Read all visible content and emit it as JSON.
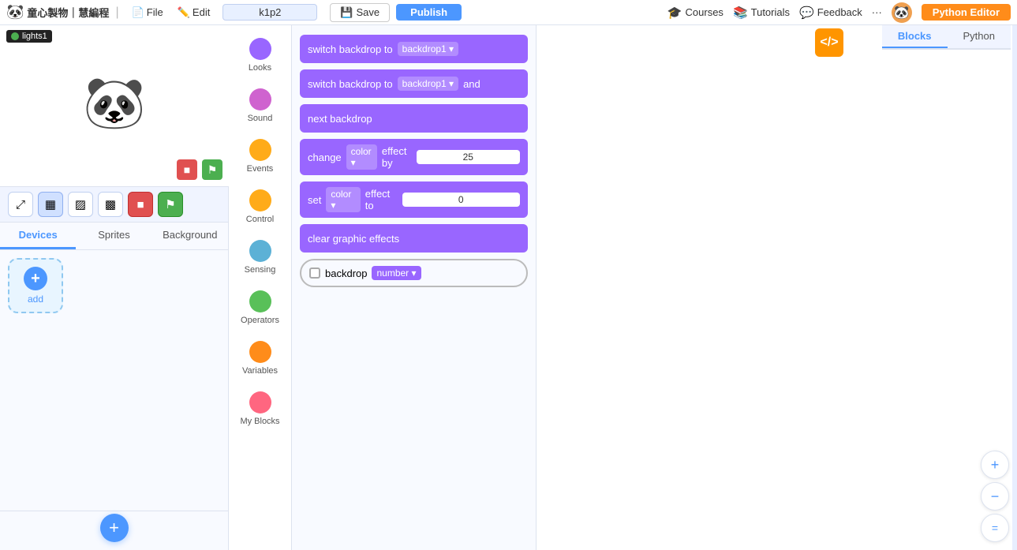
{
  "topbar": {
    "logo_text": "童心製物｜慧編程",
    "menu_file": "File",
    "menu_edit": "Edit",
    "project_name": "k1p2",
    "btn_save": "Save",
    "btn_publish": "Publish",
    "btn_courses": "Courses",
    "btn_tutorials": "Tutorials",
    "btn_feedback": "Feedback",
    "btn_python_editor": "Python Editor"
  },
  "view_controls": {
    "btn_expand": "⤢",
    "btn_grid1": "▦",
    "btn_grid2": "▨",
    "btn_grid3": "▩",
    "btn_stop": "■",
    "btn_flag": "⚑"
  },
  "sprite_tabs": {
    "devices": "Devices",
    "sprites": "Sprites",
    "background": "Background"
  },
  "stage": {
    "lights_label": "lights1",
    "panda": "🐼"
  },
  "categories": [
    {
      "id": "looks",
      "label": "Looks",
      "color": "#9966ff"
    },
    {
      "id": "sound",
      "label": "Sound",
      "color": "#cf63cf"
    },
    {
      "id": "events",
      "label": "Events",
      "color": "#ffab19"
    },
    {
      "id": "control",
      "label": "Control",
      "color": "#ffab19"
    },
    {
      "id": "sensing",
      "label": "Sensing",
      "color": "#5cb1d6"
    },
    {
      "id": "operators",
      "label": "Operators",
      "color": "#59c059"
    },
    {
      "id": "variables",
      "label": "Variables",
      "color": "#ff8c1a"
    },
    {
      "id": "my_blocks",
      "label": "My Blocks",
      "color": "#ff6680"
    }
  ],
  "blocks": [
    {
      "id": "switch_backdrop",
      "type": "purple",
      "text_pre": "switch backdrop to",
      "dropdown": "backdrop1",
      "text_post": ""
    },
    {
      "id": "switch_backdrop_and",
      "type": "purple",
      "text_pre": "switch backdrop to",
      "dropdown": "backdrop1",
      "text_post": "and"
    },
    {
      "id": "next_backdrop",
      "type": "purple",
      "text": "next backdrop"
    },
    {
      "id": "change_color_effect",
      "type": "purple",
      "text_pre": "change",
      "dropdown": "color",
      "text_mid": "effect by",
      "input": "25"
    },
    {
      "id": "set_color_effect",
      "type": "purple",
      "text_pre": "set",
      "dropdown": "color",
      "text_mid": "effect to",
      "input": "0"
    },
    {
      "id": "clear_graphic_effects",
      "type": "purple",
      "text": "clear graphic effects"
    },
    {
      "id": "backdrop_number",
      "type": "outline",
      "checkbox": true,
      "text_pre": "backdrop",
      "dropdown": "number"
    }
  ],
  "right_tabs": {
    "blocks": "Blocks",
    "python": "Python"
  },
  "add_label": "add",
  "zoom": {
    "zoom_in": "+",
    "zoom_out": "−",
    "zoom_reset": "="
  }
}
